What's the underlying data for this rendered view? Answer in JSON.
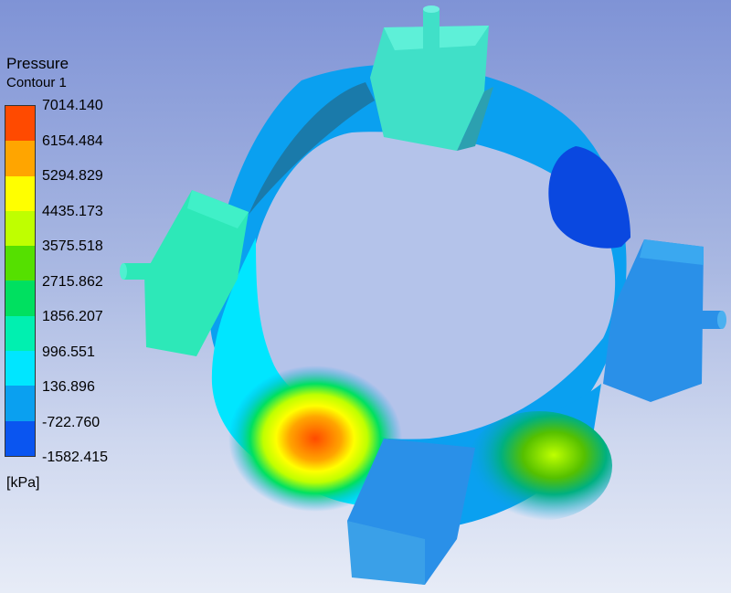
{
  "legend": {
    "title": "Pressure",
    "subtitle": "Contour 1",
    "unit": "[kPa]",
    "ticks": [
      "7014.140",
      "6154.484",
      "5294.829",
      "4435.173",
      "3575.518",
      "2715.862",
      "1856.207",
      "996.551",
      "136.896",
      "-722.760",
      "-1582.415"
    ],
    "colors": [
      "#ff4a00",
      "#ffa500",
      "#ffff00",
      "#bfff00",
      "#55e000",
      "#00e060",
      "#00f0b0",
      "#00e6ff",
      "#0aa0f0",
      "#0a55f0",
      "#0a1eee"
    ]
  },
  "scene": {
    "description_icon": "pressure-contour-bearing-icon"
  }
}
